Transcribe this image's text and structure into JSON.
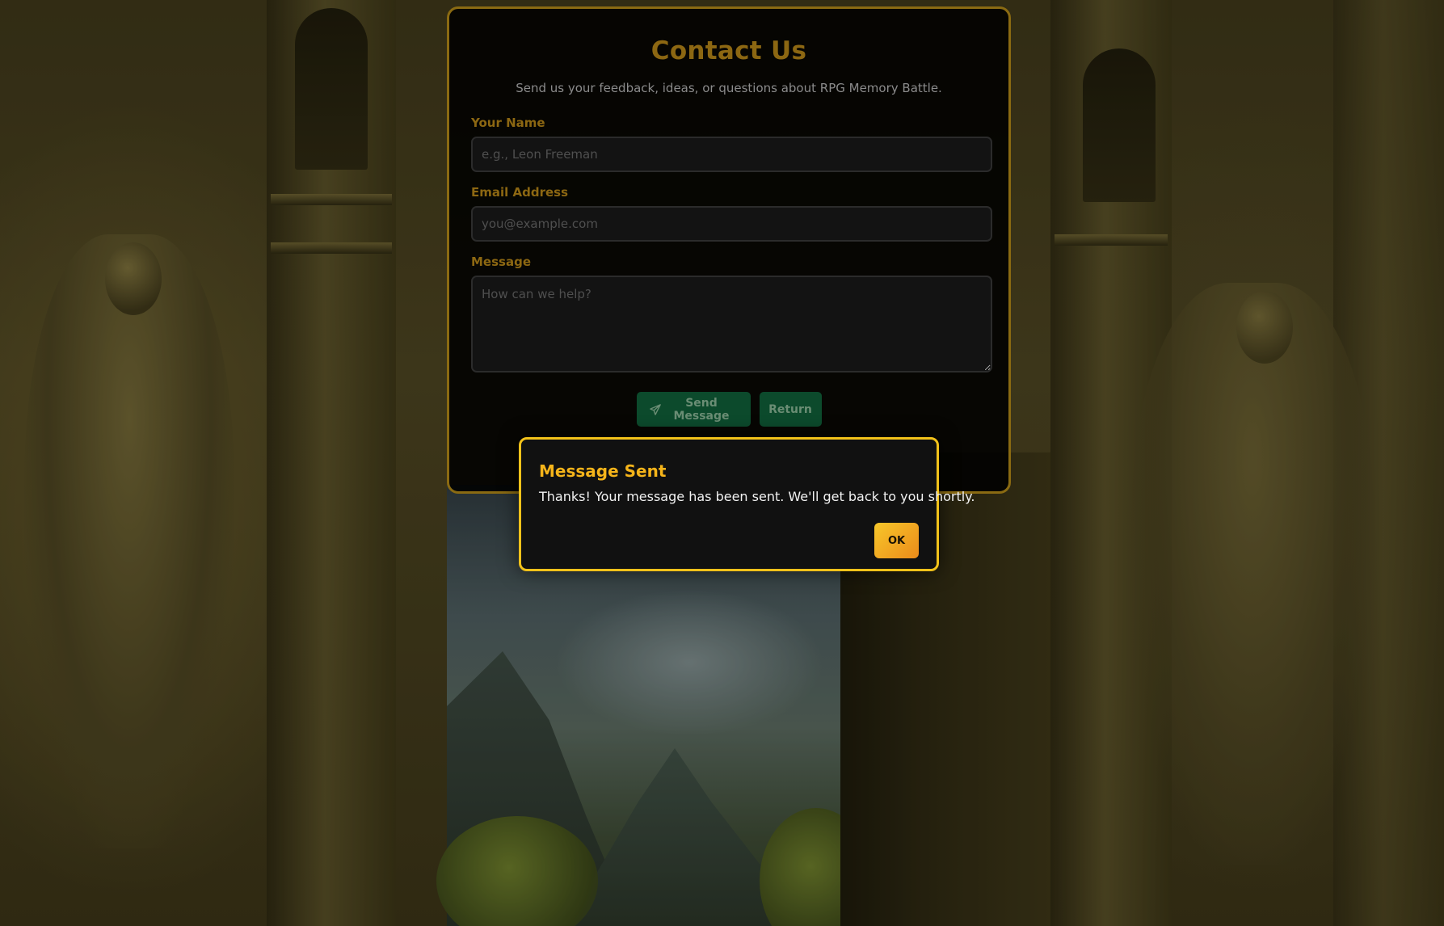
{
  "contact_form": {
    "title": "Contact Us",
    "subtitle": "Send us your feedback, ideas, or questions about RPG Memory Battle.",
    "fields": {
      "name": {
        "label": "Your Name",
        "placeholder": "e.g., Leon Freeman",
        "value": ""
      },
      "email": {
        "label": "Email Address",
        "placeholder": "you@example.com",
        "value": ""
      },
      "message": {
        "label": "Message",
        "placeholder": "How can we help?",
        "value": ""
      }
    },
    "buttons": {
      "send_label": "Send Message",
      "send_icon": "paper-plane-icon",
      "return_label": "Return"
    }
  },
  "dialog": {
    "title": "Message Sent",
    "body": "Thanks! Your message has been sent. We'll get back to you shortly.",
    "ok_label": "OK"
  },
  "colors": {
    "card_border": "#8a6a12",
    "dialog_border": "#f2c21a",
    "dialog_title": "#f5b41a",
    "button_green": "#0c4a2c",
    "ok_gradient_start": "#f7c72a",
    "ok_gradient_end": "#ec8b1a"
  }
}
